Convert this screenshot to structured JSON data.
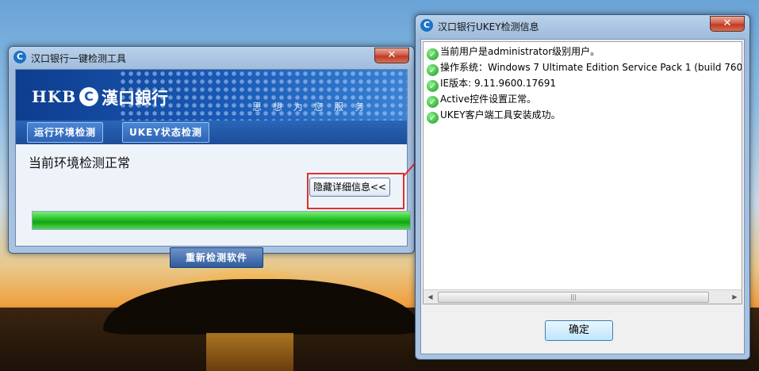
{
  "left_window": {
    "title": "汉口银行一键检测工具",
    "close_label": "✕",
    "logo": {
      "en": "HKB",
      "cn": "漢口銀行"
    },
    "slogan": "思 想 为 您 服 务",
    "tabs": [
      {
        "label": "运行环境检测"
      },
      {
        "label": "UKEY状态检测"
      }
    ],
    "status_text": "当前环境检测正常",
    "hide_detail_label": "隐藏详细信息<<",
    "progress_percent": 100,
    "redetect_label": "重新检测软件"
  },
  "right_window": {
    "title": "汉口银行UKEY检测信息",
    "close_label": "✕",
    "info_items": [
      {
        "text": "当前用户是administrator级别用户。"
      },
      {
        "text": "操作系统：Windows 7 Ultimate Edition Service Pack 1 (build 760"
      },
      {
        "text": "IE版本: 9.11.9600.17691"
      },
      {
        "text": "Active控件设置正常。"
      },
      {
        "text": "UKEY客户端工具安装成功。"
      }
    ],
    "ok_label": "确定"
  },
  "colors": {
    "annotation_red": "#e0302c",
    "progress_green": "#13a313",
    "bank_blue": "#1a5ab5"
  },
  "icons": {
    "app_icon": "bank-logo-icon",
    "status_icon": "green-check-icon"
  }
}
